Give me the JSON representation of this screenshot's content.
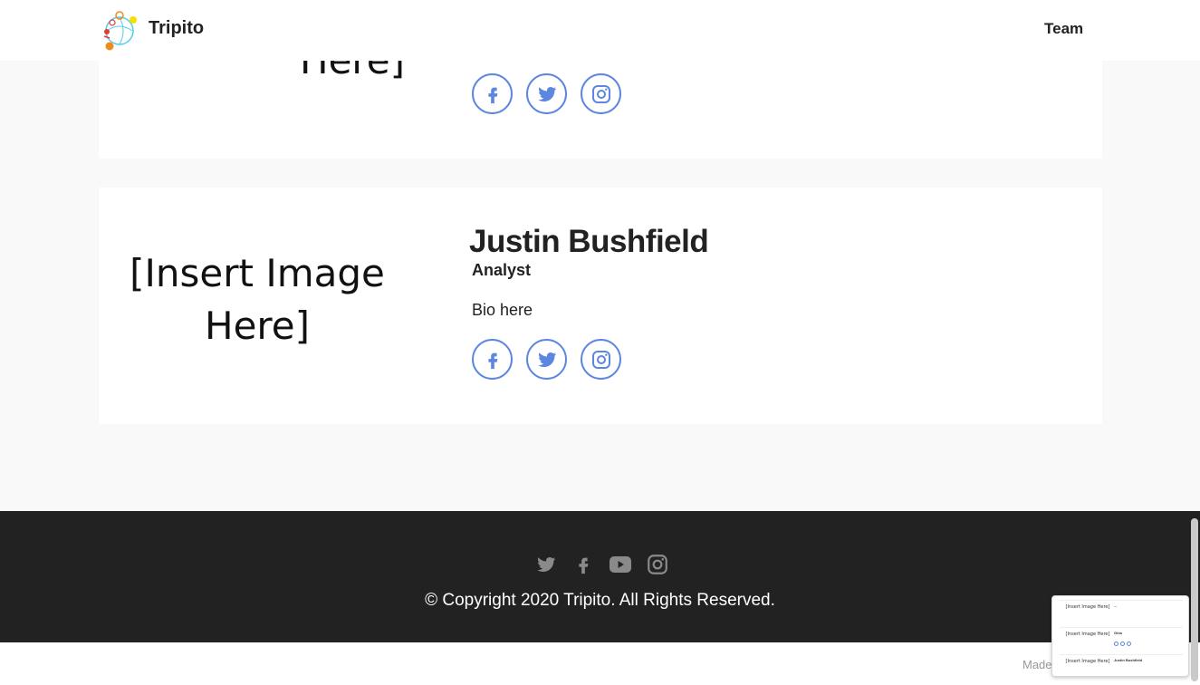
{
  "header": {
    "brand": "Tripito",
    "nav_team": "Team"
  },
  "cards": [
    {
      "image_placeholder": "Here]",
      "social": [
        "facebook-icon",
        "twitter-icon",
        "instagram-icon"
      ]
    },
    {
      "image_placeholder_line1": "[Insert Image",
      "image_placeholder_line2": "Here]",
      "name": "Justin Bushfield",
      "role": "Analyst",
      "bio": "Bio here",
      "social": [
        "facebook-icon",
        "twitter-icon",
        "instagram-icon"
      ]
    }
  ],
  "footer": {
    "icons": [
      "twitter-icon",
      "facebook-icon",
      "youtube-icon",
      "instagram-icon"
    ],
    "copyright": "© Copyright 2020 Tripito. All Rights Reserved."
  },
  "bottom": {
    "made_with": "Made"
  },
  "thumbnail": {
    "rows": [
      {
        "img": "[Insert Image Here]",
        "name": "..."
      },
      {
        "img": "[Insert Image Here]",
        "name": "Ghia"
      },
      {
        "img": "[Insert Image Here]",
        "name": "Justin Bushfield"
      }
    ]
  },
  "colors": {
    "accent": "#5d86e0",
    "footer_bg": "#222222",
    "page_bg": "#f9f9f9"
  }
}
